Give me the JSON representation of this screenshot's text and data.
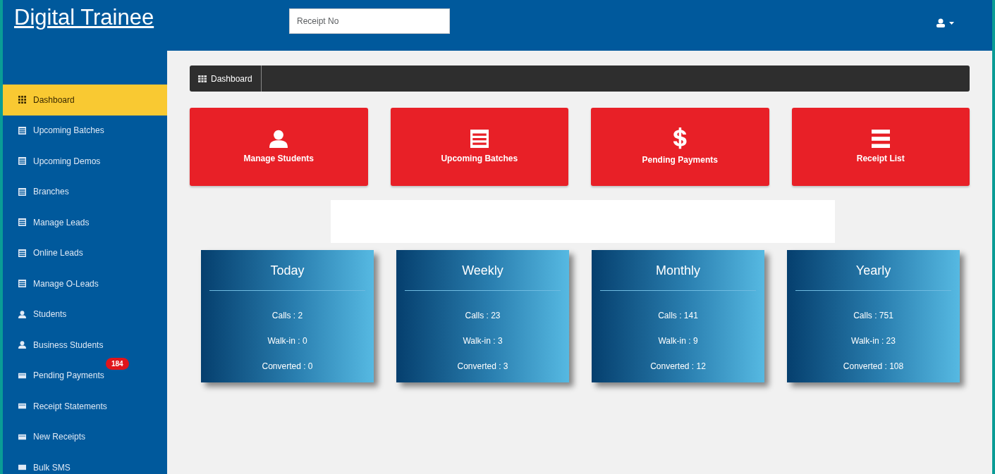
{
  "header": {
    "brand": "Digital Trainee",
    "search": {
      "placeholder": "Receipt No"
    }
  },
  "sidebar": {
    "items": [
      {
        "label": "Dashboard",
        "kind": "grid",
        "selected": true
      },
      {
        "label": "Upcoming Batches",
        "kind": "list",
        "selected": false
      },
      {
        "label": "Upcoming Demos",
        "kind": "list",
        "selected": false
      },
      {
        "label": "Branches",
        "kind": "list",
        "selected": false
      },
      {
        "label": "Manage Leads",
        "kind": "list",
        "selected": false
      },
      {
        "label": "Online Leads",
        "kind": "list",
        "selected": false
      },
      {
        "label": "Manage O-Leads",
        "kind": "list",
        "selected": false
      },
      {
        "label": "Students",
        "kind": "user",
        "selected": false
      },
      {
        "label": "Business Students",
        "kind": "user",
        "selected": false
      },
      {
        "label": "Pending Payments",
        "kind": "card",
        "selected": false,
        "badge": "184"
      },
      {
        "label": "Receipt Statements",
        "kind": "card",
        "selected": false
      },
      {
        "label": "New Receipts",
        "kind": "card",
        "selected": false
      },
      {
        "label": "Bulk SMS",
        "kind": "mail",
        "selected": false
      }
    ]
  },
  "breadcrumb": "Dashboard",
  "tiles": [
    {
      "label": "Manage Students",
      "kind": "user"
    },
    {
      "label": "Upcoming Batches",
      "kind": "list"
    },
    {
      "label": "Pending Payments",
      "kind": "dollar"
    },
    {
      "label": "Receipt List",
      "kind": "bars"
    }
  ],
  "stats": [
    {
      "title": "Today",
      "lines": [
        "Calls : 2",
        "Walk-in : 0",
        "Converted : 0"
      ]
    },
    {
      "title": "Weekly",
      "lines": [
        "Calls : 23",
        "Walk-in : 3",
        "Converted : 3"
      ]
    },
    {
      "title": "Monthly",
      "lines": [
        "Calls : 141",
        "Walk-in : 9",
        "Converted : 12"
      ]
    },
    {
      "title": "Yearly",
      "lines": [
        "Calls : 751",
        "Walk-in : 23",
        "Converted : 108"
      ]
    }
  ]
}
